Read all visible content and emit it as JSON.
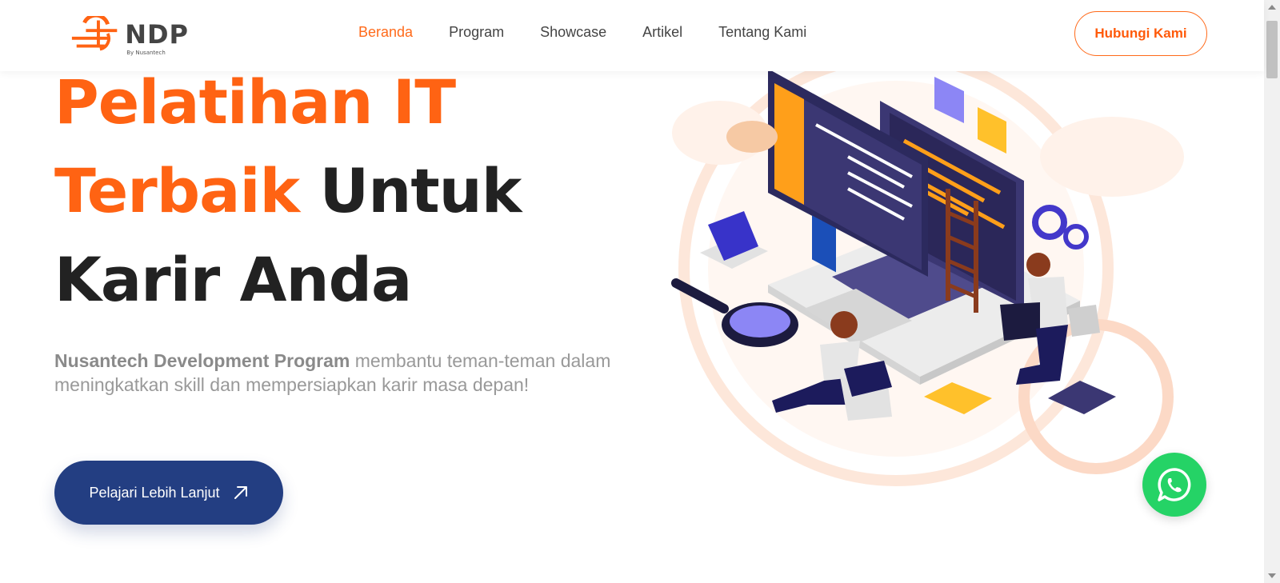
{
  "brand": {
    "name": "NDP",
    "tagline": "By Nusantech",
    "accent_color": "#ff6313",
    "primary_dark": "#233e82",
    "logo_icon": "ndp-logo-icon"
  },
  "nav": {
    "items": [
      {
        "label": "Beranda",
        "active": true
      },
      {
        "label": "Program",
        "active": false
      },
      {
        "label": "Showcase",
        "active": false
      },
      {
        "label": "Artikel",
        "active": false
      },
      {
        "label": "Tentang Kami",
        "active": false
      }
    ],
    "cta_label": "Hubungi Kami"
  },
  "hero": {
    "title_line1": "Pelatihan IT",
    "title_line2_accent": "Terbaik",
    "title_line2_rest": "Untuk",
    "title_line3": "Karir Anda",
    "desc_strong": "Nusantech Development Program",
    "desc_rest": "membantu teman-teman dalam meningkatkan skill dan mempersiapkan karir masa depan!",
    "button_label": "Pelajari Lebih Lanjut",
    "button_icon": "arrow-up-right-icon",
    "illustration": "laptop-coding-team-illustration"
  },
  "floating": {
    "whatsapp_icon": "whatsapp-icon",
    "whatsapp_color": "#25d366"
  }
}
